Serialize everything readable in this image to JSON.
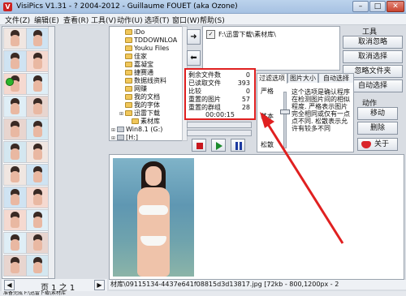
{
  "window": {
    "title": "VisiPics V1.31 - ? 2004-2012 - Guillaume FOUET (aka Ozone)",
    "min": "–",
    "max": "□",
    "close": "✕"
  },
  "menu": [
    "文件(Z)",
    "编辑(E)",
    "查看(R)",
    "工具(V)",
    "动作(U)",
    "选项(T)",
    "窗口(W)",
    "帮助(S)"
  ],
  "folder_tree": [
    {
      "label": "iDo",
      "icon": "folder-icon"
    },
    {
      "label": "TDDOWNLOA",
      "icon": "folder-icon"
    },
    {
      "label": "Youku Files",
      "icon": "folder-icon"
    },
    {
      "label": "佳家",
      "icon": "folder-icon"
    },
    {
      "label": "嘉凝宝",
      "icon": "folder-icon"
    },
    {
      "label": "捷赛通",
      "icon": "folder-icon"
    },
    {
      "label": "数据线资料",
      "icon": "folder-icon"
    },
    {
      "label": "网赚",
      "icon": "folder-icon"
    },
    {
      "label": "我的文档",
      "icon": "folder-icon"
    },
    {
      "label": "我的字体",
      "icon": "folder-icon"
    },
    {
      "label": "迅雷下载",
      "icon": "folder-icon"
    },
    {
      "label": "素材库",
      "icon": "folder-icon"
    },
    {
      "label": "Win8.1 (G:)",
      "icon": "drive-icon"
    },
    {
      "label": "[H:]",
      "icon": "drive-icon"
    }
  ],
  "path": {
    "value": "F:\\迅雷下载\\素材库\\"
  },
  "tools": {
    "label": "工具",
    "buttons": [
      "取消忽略",
      "取消选择",
      "忽略文件夹",
      "自动选择"
    ]
  },
  "actions": {
    "label": "动作",
    "buttons": [
      "移动",
      "删除"
    ],
    "about": "关于"
  },
  "stats": {
    "rows": [
      {
        "label": "剩余文件数",
        "value": "0"
      },
      {
        "label": "已读取文件",
        "value": "393"
      },
      {
        "label": "比较",
        "value": "0"
      },
      {
        "label": "重置的图片",
        "value": "57"
      },
      {
        "label": "重置的群组",
        "value": "28"
      }
    ],
    "time": "00:00:15"
  },
  "tabs": {
    "items": [
      "过滤选项",
      "图片大小",
      "自动选择"
    ],
    "levels": [
      "严格",
      "基本",
      "松散"
    ],
    "description": "这个选项是确认程序在检测图片间的相似程度. 严格表示图片完全相同或仅有一点点不同. 松散表示允许有较多不同"
  },
  "pager": {
    "label": "页 1 之 1",
    "prev": "◀",
    "next": "▶"
  },
  "file_info": "材库\\09115134-4437e641f08815d3d13817.jpg [72kb - 800,1200px - 2",
  "status": "准备完成 F:\\迅雷下载\\素材库"
}
